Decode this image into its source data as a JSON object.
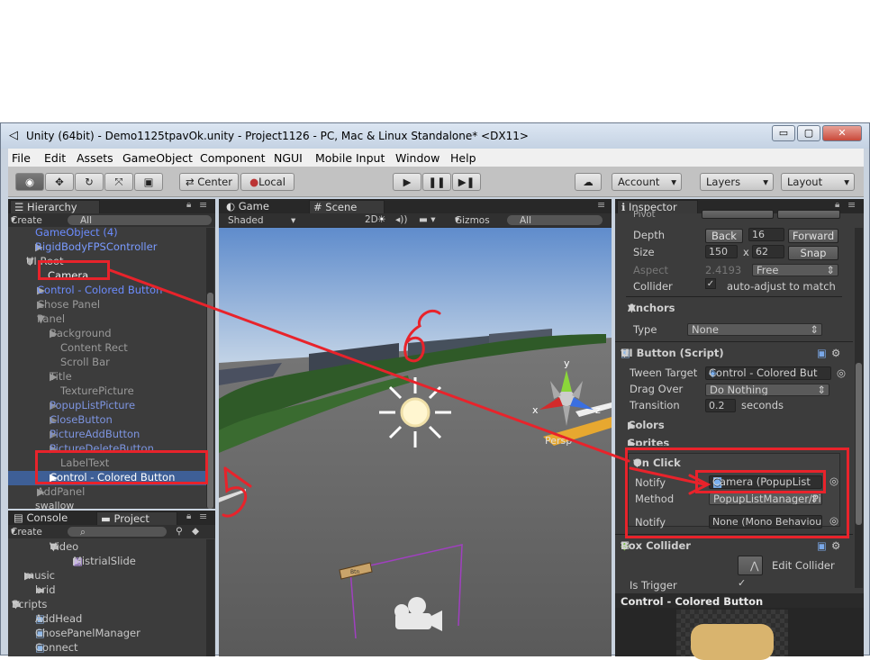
{
  "window": {
    "title": "Unity (64bit) - Demo1125tpavOk.unity - Project1126 - PC, Mac & Linux Standalone* <DX11>"
  },
  "menu": [
    "File",
    "Edit",
    "Assets",
    "GameObject",
    "Component",
    "NGUI",
    "Mobile Input",
    "Window",
    "Help"
  ],
  "toolbar": {
    "center": "Center",
    "local": "Local",
    "account": "Account",
    "layers": "Layers",
    "layout": "Layout"
  },
  "hierarchy": {
    "tab": "Hierarchy",
    "create": "Create",
    "search_placeholder": "All",
    "items": [
      "GameObject (4)",
      "RigidBodyFPSController",
      "UI Root",
      "Camera",
      "Control - Colored Button",
      "Chose Panel",
      "Panel",
      "Background",
      "Content Rect",
      "Scroll Bar",
      "Title",
      "TexturePicture",
      "PopupListPicture",
      "CloseButton",
      "PictureAddButton",
      "PictureDeleteButton",
      "LabelText",
      "Control - Colored Button",
      "AddPanel",
      "swallow"
    ]
  },
  "project": {
    "console_tab": "Console",
    "project_tab": "Project",
    "create": "Create",
    "items": [
      "Video",
      "MistrialSlide",
      "music",
      "brid",
      "Scripts",
      "AddHead",
      "ChosePanelManager",
      "Connect"
    ]
  },
  "scene": {
    "game_tab": "Game",
    "scene_tab": "Scene",
    "shaded": "Shaded",
    "mode2d": "2D",
    "gizmos": "Gizmos",
    "search_placeholder": "All",
    "persp": "Persp",
    "axis_x": "x",
    "axis_y": "y",
    "axis_z": "z"
  },
  "inspector": {
    "tab": "Inspector",
    "pivot": "Pivot",
    "depth_label": "Depth",
    "back": "Back",
    "depth_value": "16",
    "forward": "Forward",
    "size_label": "Size",
    "size_w": "150",
    "size_x": "x",
    "size_h": "62",
    "snap": "Snap",
    "aspect_label": "Aspect",
    "aspect_value": "2.4193",
    "aspect_mode": "Free",
    "collider_label": "Collider",
    "collider_text": "auto-adjust to match",
    "anchors_title": "Anchors",
    "type_label": "Type",
    "type_value": "None",
    "uibutton_title": "UI Button (Script)",
    "tween_label": "Tween Target",
    "tween_value": "Control - Colored But",
    "dragover_label": "Drag Over",
    "dragover_value": "Do Nothing",
    "transition_label": "Transition",
    "transition_value": "0.2",
    "seconds": "seconds",
    "colors": "Colors",
    "sprites": "Sprites",
    "onclick": "On Click",
    "notify_label": "Notify",
    "notify_value": "Camera (PopupList",
    "method_label": "Method",
    "method_value": "PopupListManager/Pi",
    "notify2_value": "None (Mono Behaviou",
    "boxcollider_title": "Box Collider",
    "edit_collider": "Edit Collider",
    "trigger_label": "Is Trigger",
    "preview_title": "Control - Colored Button"
  },
  "annotations": {
    "sprite_text": "Btn"
  }
}
